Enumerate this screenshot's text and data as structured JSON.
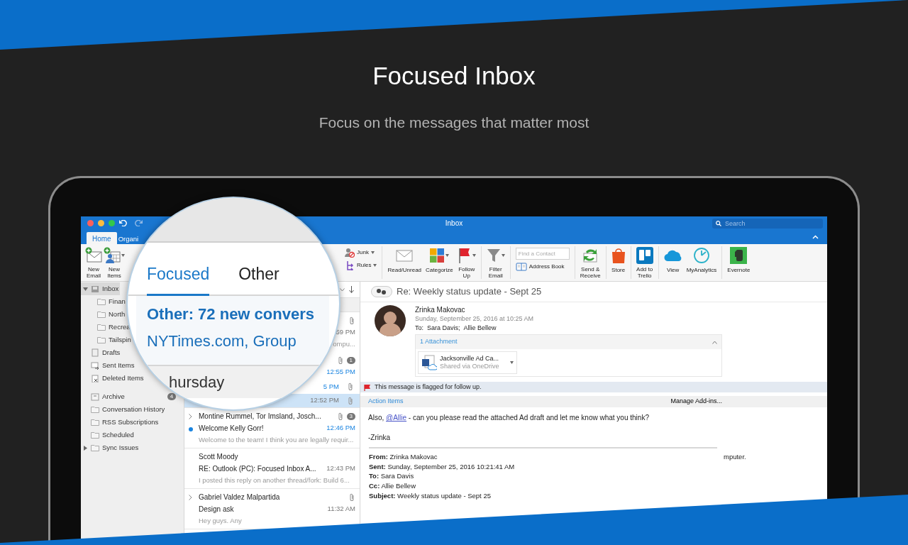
{
  "hero": {
    "title": "Focused Inbox",
    "subtitle": "Focus on the messages that matter most"
  },
  "window": {
    "title": "Inbox",
    "search_placeholder": "Search"
  },
  "ribbon_tabs": [
    {
      "label": "Home",
      "selected": true
    },
    {
      "label": "Organi",
      "selected": false
    }
  ],
  "ribbon_groups": [
    {
      "kind": "row",
      "items": [
        {
          "kind": "email",
          "label": "New\nEmail",
          "dropdown": false
        },
        {
          "kind": "items",
          "label": "New\nItems",
          "dropdown": true
        }
      ]
    },
    {
      "kind": "stack",
      "items": [
        {
          "kind": "junk",
          "label": "Junk",
          "dropdown": true
        },
        {
          "kind": "rules",
          "label": "Rules",
          "dropdown": true
        }
      ]
    },
    {
      "kind": "row",
      "items": [
        {
          "kind": "envelope",
          "label": "Read/Unread",
          "dropdown": false
        },
        {
          "kind": "categorize",
          "label": "Categorize",
          "dropdown": true
        },
        {
          "kind": "flag",
          "label": "Follow\nUp",
          "dropdown": true
        }
      ]
    },
    {
      "kind": "row",
      "items": [
        {
          "kind": "funnel",
          "label": "Filter\nEmail",
          "dropdown": true
        }
      ]
    },
    {
      "kind": "stack",
      "items": [
        {
          "kind": "field",
          "placeholder": "Find a Contact"
        },
        {
          "kind": "book",
          "label": "Address Book",
          "dropdown": false
        }
      ]
    },
    {
      "kind": "row",
      "items": [
        {
          "kind": "sync",
          "label": "Send &\nReceive",
          "dropdown": false
        }
      ]
    },
    {
      "kind": "row",
      "items": [
        {
          "kind": "store",
          "label": "Store",
          "dropdown": false
        }
      ]
    },
    {
      "kind": "row",
      "items": [
        {
          "kind": "trello",
          "label": "Add to\nTrello",
          "dropdown": false
        }
      ]
    },
    {
      "kind": "row",
      "items": [
        {
          "kind": "cloud",
          "label": "View",
          "dropdown": false
        },
        {
          "kind": "analytics",
          "label": "MyAnalytics",
          "dropdown": false
        }
      ]
    },
    {
      "kind": "row",
      "items": [
        {
          "kind": "evernote",
          "label": "Evernote",
          "dropdown": false
        }
      ]
    }
  ],
  "folders": [
    {
      "kind": "inbox",
      "label": "Inbox",
      "selected": true,
      "expanded": true,
      "children": [
        {
          "kind": "folder",
          "label": "Finan",
          "selected": false
        },
        {
          "kind": "folder",
          "label": "North",
          "selected": false
        },
        {
          "kind": "folder",
          "label": "Recrea",
          "selected": false
        },
        {
          "kind": "folder",
          "label": "Tailspin",
          "selected": false
        }
      ]
    },
    {
      "kind": "drafts",
      "label": "Drafts",
      "selected": false
    },
    {
      "kind": "sent",
      "label": "Sent Items",
      "selected": false
    },
    {
      "kind": "deleted",
      "label": "Deleted Items",
      "selected": false
    },
    {
      "kind": "archive",
      "label": "Archive",
      "selected": false,
      "badge": "4",
      "group_start": true
    },
    {
      "kind": "folder",
      "label": "Conversation History",
      "selected": false
    },
    {
      "kind": "folder",
      "label": "RSS Subscriptions",
      "selected": false
    },
    {
      "kind": "folder",
      "label": "Scheduled",
      "selected": false
    },
    {
      "kind": "folder",
      "label": "Sync Issues",
      "selected": false,
      "expanded": false
    }
  ],
  "messages": [
    {
      "kind": "message",
      "selected": false,
      "unread": false,
      "expandable": false,
      "attachment": true,
      "time": "59 PM",
      "preview": "ompu..."
    },
    {
      "kind": "message",
      "selected": false,
      "unread": true,
      "expandable": false,
      "attachment": true,
      "count": "1",
      "time": "12:55 PM"
    },
    {
      "kind": "thread",
      "selected": false,
      "unread": true,
      "expandable": false,
      "attachment": true,
      "time": "5 PM"
    },
    {
      "kind": "thread",
      "selected": true,
      "unread": false,
      "expandable": false,
      "attachment": true,
      "time": "12:52 PM"
    },
    {
      "kind": "message",
      "selected": false,
      "unread": true,
      "expandable": true,
      "attachment": true,
      "count": "3",
      "sender": "Montine Rummel, Tor Imsland, Josch...",
      "subject": "Welcome Kelly Gorr!",
      "time": "12:46 PM",
      "preview": "Welcome to the team! I think you are legally requir..."
    },
    {
      "kind": "message",
      "selected": false,
      "unread": false,
      "expandable": false,
      "attachment": false,
      "sender": "Scott Moody",
      "subject": "RE: Outlook (PC): Focused Inbox A...",
      "time": "12:43 PM",
      "preview": "I posted this reply on another thread/fork: Build 6..."
    },
    {
      "kind": "message",
      "selected": false,
      "unread": false,
      "expandable": true,
      "attachment": true,
      "sender": "Gabriel Valdez Malpartida",
      "subject": "Design ask",
      "time": "11:32 AM",
      "preview": "Hey guys. Any"
    }
  ],
  "magnifier": {
    "tabs": [
      {
        "label": "Focused",
        "selected": true
      },
      {
        "label": "Other",
        "selected": false
      }
    ],
    "other_summary": "Other: 72 new convers",
    "other_senders": "NYTimes.com, Group",
    "day_header": "hursday"
  },
  "reading_pane": {
    "subject": "Re: Weekly status update - Sept 25",
    "sender": "Zrinka Makovac",
    "date": "Sunday, September 25, 2016 at 10:25 AM",
    "to_label": "To:",
    "recipients": [
      "Sara Davis;",
      "Allie Bellew"
    ],
    "attachments_header": "1 Attachment",
    "attachments_expanded": true,
    "attachment": {
      "name": "Jacksonville Ad Ca...",
      "note": "Shared via OneDrive"
    },
    "flag_note": "This message is flagged for follow up.",
    "action_items": "Action Items",
    "manage_addins": "Manage Add-ins...",
    "body": {
      "before": "Also,",
      "mention": "@Allie",
      "after": "- can you please read the attached Ad draft and let me know what you think?",
      "signature": "-Zrinka"
    },
    "quoted": [
      "**From:** Zrinka Makovac",
      "**Sent:** Sunday, September 25, 2016 10:21:41 AM",
      "**To:** Sara Davis",
      "**Cc:** Allie Bellew",
      "**Subject:** Weekly status update - Sept 25"
    ],
    "quoted_fragment": "mputer."
  }
}
